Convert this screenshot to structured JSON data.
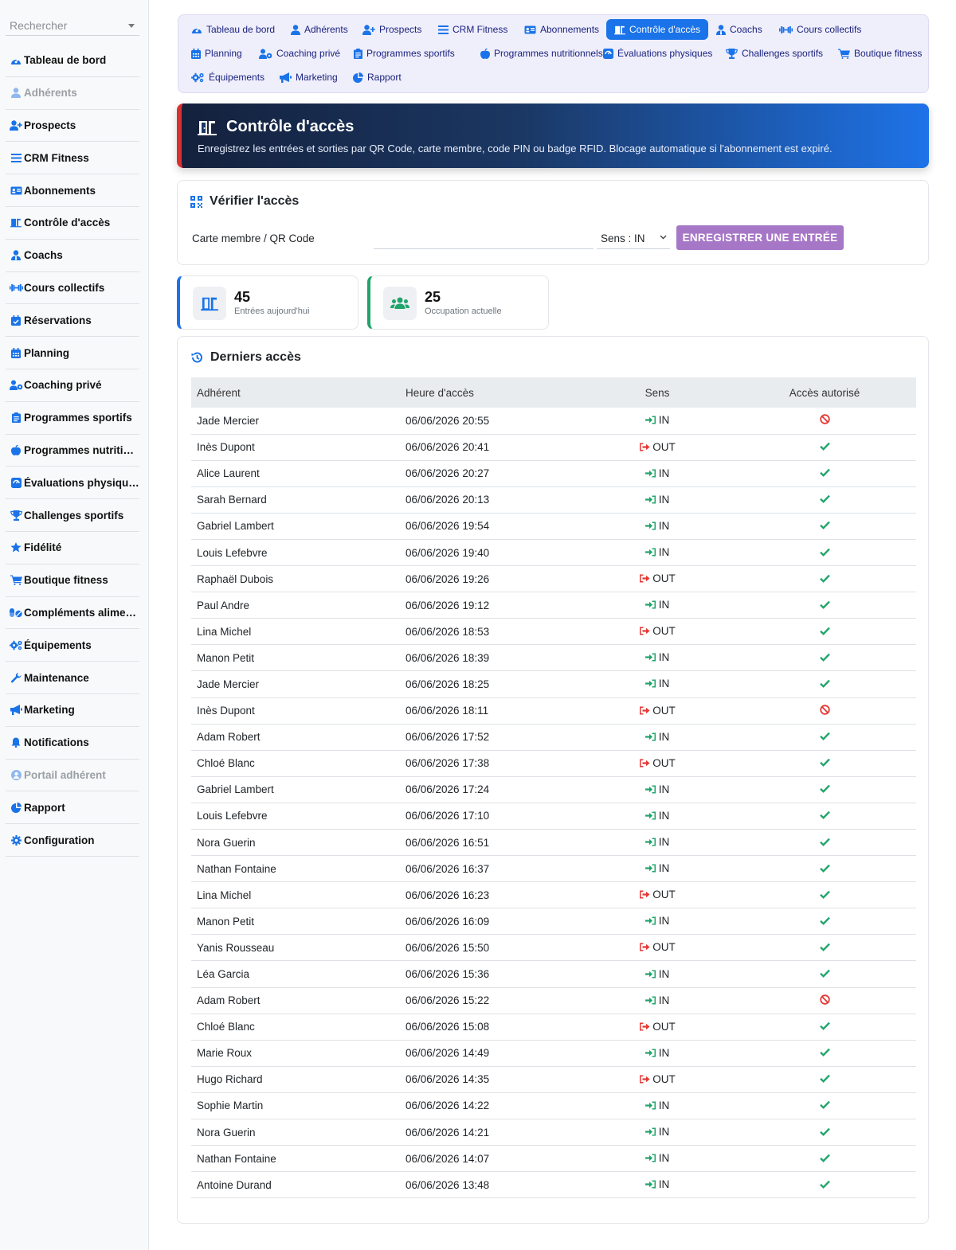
{
  "sidebar": {
    "search_placeholder": "Rechercher",
    "items": [
      {
        "label": "Tableau de bord",
        "icon": "dashboard-icon",
        "muted": false
      },
      {
        "label": "Adhérents",
        "icon": "user-icon",
        "muted": true
      },
      {
        "label": "Prospects",
        "icon": "user-plus-icon",
        "muted": false
      },
      {
        "label": "CRM Fitness",
        "icon": "list-icon",
        "muted": false
      },
      {
        "label": "Abonnements",
        "icon": "id-card-icon",
        "muted": false
      },
      {
        "label": "Contrôle d'accès",
        "icon": "door-icon",
        "muted": false
      },
      {
        "label": "Coachs",
        "icon": "user-tie-icon",
        "muted": false
      },
      {
        "label": "Cours collectifs",
        "icon": "dumbbell-icon",
        "muted": false
      },
      {
        "label": "Réservations",
        "icon": "calendar-check-icon",
        "muted": false
      },
      {
        "label": "Planning",
        "icon": "calendar-icon",
        "muted": false
      },
      {
        "label": "Coaching privé",
        "icon": "users-gear-icon",
        "muted": false
      },
      {
        "label": "Programmes sportifs",
        "icon": "clipboard-icon",
        "muted": false
      },
      {
        "label": "Programmes nutritionnels",
        "icon": "apple-icon",
        "muted": false
      },
      {
        "label": "Évaluations physiques",
        "icon": "scale-icon",
        "muted": false
      },
      {
        "label": "Challenges sportifs",
        "icon": "trophy-icon",
        "muted": false
      },
      {
        "label": "Fidélité",
        "icon": "star-icon",
        "muted": false
      },
      {
        "label": "Boutique fitness",
        "icon": "cart-icon",
        "muted": false
      },
      {
        "label": "Compléments alimentaires",
        "icon": "pills-icon",
        "muted": false
      },
      {
        "label": "Équipements",
        "icon": "gears-icon",
        "muted": false
      },
      {
        "label": "Maintenance",
        "icon": "wrench-icon",
        "muted": false
      },
      {
        "label": "Marketing",
        "icon": "bullhorn-icon",
        "muted": false
      },
      {
        "label": "Notifications",
        "icon": "bell-icon",
        "muted": false
      },
      {
        "label": "Portail adhérent",
        "icon": "user-circle-icon",
        "muted": true
      },
      {
        "label": "Rapport",
        "icon": "pie-chart-icon",
        "muted": false
      },
      {
        "label": "Configuration",
        "icon": "gear-icon",
        "muted": false
      }
    ]
  },
  "topnav": {
    "items": [
      {
        "label": "Tableau de bord",
        "icon": "dashboard-icon",
        "active": false
      },
      {
        "label": "Adhérents",
        "icon": "user-icon",
        "active": false
      },
      {
        "label": "Prospects",
        "icon": "user-plus-icon",
        "active": false
      },
      {
        "label": "CRM Fitness",
        "icon": "list-icon",
        "active": false
      },
      {
        "label": "Abonnements",
        "icon": "id-card-icon",
        "active": false
      },
      {
        "label": "Contrôle d'accès",
        "icon": "door-icon",
        "active": true
      },
      {
        "label": "Coachs",
        "icon": "user-tie-icon",
        "active": false
      },
      {
        "label": "Cours collectifs",
        "icon": "dumbbell-icon",
        "active": false
      },
      {
        "label": "Planning",
        "icon": "calendar-icon",
        "active": false
      },
      {
        "label": "Coaching privé",
        "icon": "users-gear-icon",
        "active": false
      },
      {
        "label": "Programmes sportifs",
        "icon": "clipboard-icon",
        "active": false
      },
      {
        "label": "Programmes nutritionnels",
        "icon": "apple-icon",
        "active": false
      },
      {
        "label": "Évaluations physiques",
        "icon": "scale-icon",
        "active": false
      },
      {
        "label": "Challenges sportifs",
        "icon": "trophy-icon",
        "active": false
      },
      {
        "label": "Boutique fitness",
        "icon": "cart-icon",
        "active": false
      },
      {
        "label": "Équipements",
        "icon": "gears-icon",
        "active": false
      },
      {
        "label": "Marketing",
        "icon": "bullhorn-icon",
        "active": false
      },
      {
        "label": "Rapport",
        "icon": "pie-chart-icon",
        "active": false
      }
    ]
  },
  "hero": {
    "title": "Contrôle d'accès",
    "subtitle": "Enregistrez les entrées et sorties par QR Code, carte membre, code PIN ou badge RFID. Blocage automatique si l'abonnement est expiré."
  },
  "verify": {
    "title": "Vérifier l'accès",
    "field_label": "Carte membre / QR Code",
    "field_value": "",
    "direction_value": "Sens : IN",
    "submit_label": "ENREGISTRER UNE ENTRÉE"
  },
  "stats": {
    "entries": {
      "value": "45",
      "label": "Entrées aujourd'hui"
    },
    "occupancy": {
      "value": "25",
      "label": "Occupation actuelle"
    }
  },
  "recent": {
    "title": "Derniers accès",
    "columns": [
      "Adhérent",
      "Heure d'accès",
      "Sens",
      "Accès autorisé"
    ],
    "rows": [
      {
        "member": "Jade Mercier",
        "time": "06/06/2026 20:55",
        "dir": "IN",
        "allowed": false
      },
      {
        "member": "Inès Dupont",
        "time": "06/06/2026 20:41",
        "dir": "OUT",
        "allowed": true
      },
      {
        "member": "Alice Laurent",
        "time": "06/06/2026 20:27",
        "dir": "IN",
        "allowed": true
      },
      {
        "member": "Sarah Bernard",
        "time": "06/06/2026 20:13",
        "dir": "IN",
        "allowed": true
      },
      {
        "member": "Gabriel Lambert",
        "time": "06/06/2026 19:54",
        "dir": "IN",
        "allowed": true
      },
      {
        "member": "Louis Lefebvre",
        "time": "06/06/2026 19:40",
        "dir": "IN",
        "allowed": true
      },
      {
        "member": "Raphaël Dubois",
        "time": "06/06/2026 19:26",
        "dir": "OUT",
        "allowed": true
      },
      {
        "member": "Paul Andre",
        "time": "06/06/2026 19:12",
        "dir": "IN",
        "allowed": true
      },
      {
        "member": "Lina Michel",
        "time": "06/06/2026 18:53",
        "dir": "OUT",
        "allowed": true
      },
      {
        "member": "Manon Petit",
        "time": "06/06/2026 18:39",
        "dir": "IN",
        "allowed": true
      },
      {
        "member": "Jade Mercier",
        "time": "06/06/2026 18:25",
        "dir": "IN",
        "allowed": true
      },
      {
        "member": "Inès Dupont",
        "time": "06/06/2026 18:11",
        "dir": "OUT",
        "allowed": false
      },
      {
        "member": "Adam Robert",
        "time": "06/06/2026 17:52",
        "dir": "IN",
        "allowed": true
      },
      {
        "member": "Chloé Blanc",
        "time": "06/06/2026 17:38",
        "dir": "OUT",
        "allowed": true
      },
      {
        "member": "Gabriel Lambert",
        "time": "06/06/2026 17:24",
        "dir": "IN",
        "allowed": true
      },
      {
        "member": "Louis Lefebvre",
        "time": "06/06/2026 17:10",
        "dir": "IN",
        "allowed": true
      },
      {
        "member": "Nora Guerin",
        "time": "06/06/2026 16:51",
        "dir": "IN",
        "allowed": true
      },
      {
        "member": "Nathan Fontaine",
        "time": "06/06/2026 16:37",
        "dir": "IN",
        "allowed": true
      },
      {
        "member": "Lina Michel",
        "time": "06/06/2026 16:23",
        "dir": "OUT",
        "allowed": true
      },
      {
        "member": "Manon Petit",
        "time": "06/06/2026 16:09",
        "dir": "IN",
        "allowed": true
      },
      {
        "member": "Yanis Rousseau",
        "time": "06/06/2026 15:50",
        "dir": "OUT",
        "allowed": true
      },
      {
        "member": "Léa Garcia",
        "time": "06/06/2026 15:36",
        "dir": "IN",
        "allowed": true
      },
      {
        "member": "Adam Robert",
        "time": "06/06/2026 15:22",
        "dir": "IN",
        "allowed": false
      },
      {
        "member": "Chloé Blanc",
        "time": "06/06/2026 15:08",
        "dir": "OUT",
        "allowed": true
      },
      {
        "member": "Marie Roux",
        "time": "06/06/2026 14:49",
        "dir": "IN",
        "allowed": true
      },
      {
        "member": "Hugo Richard",
        "time": "06/06/2026 14:35",
        "dir": "OUT",
        "allowed": true
      },
      {
        "member": "Sophie Martin",
        "time": "06/06/2026 14:22",
        "dir": "IN",
        "allowed": true
      },
      {
        "member": "Nora Guerin",
        "time": "06/06/2026 14:21",
        "dir": "IN",
        "allowed": true
      },
      {
        "member": "Nathan Fontaine",
        "time": "06/06/2026 14:07",
        "dir": "IN",
        "allowed": true
      },
      {
        "member": "Antoine Durand",
        "time": "06/06/2026 13:48",
        "dir": "IN",
        "allowed": true
      }
    ]
  },
  "colors": {
    "accent": "#1a73e8",
    "in": "#20a46b",
    "out": "#e53935",
    "allowed": "#20a46b",
    "denied": "#e53935",
    "button": "#a777c7"
  }
}
